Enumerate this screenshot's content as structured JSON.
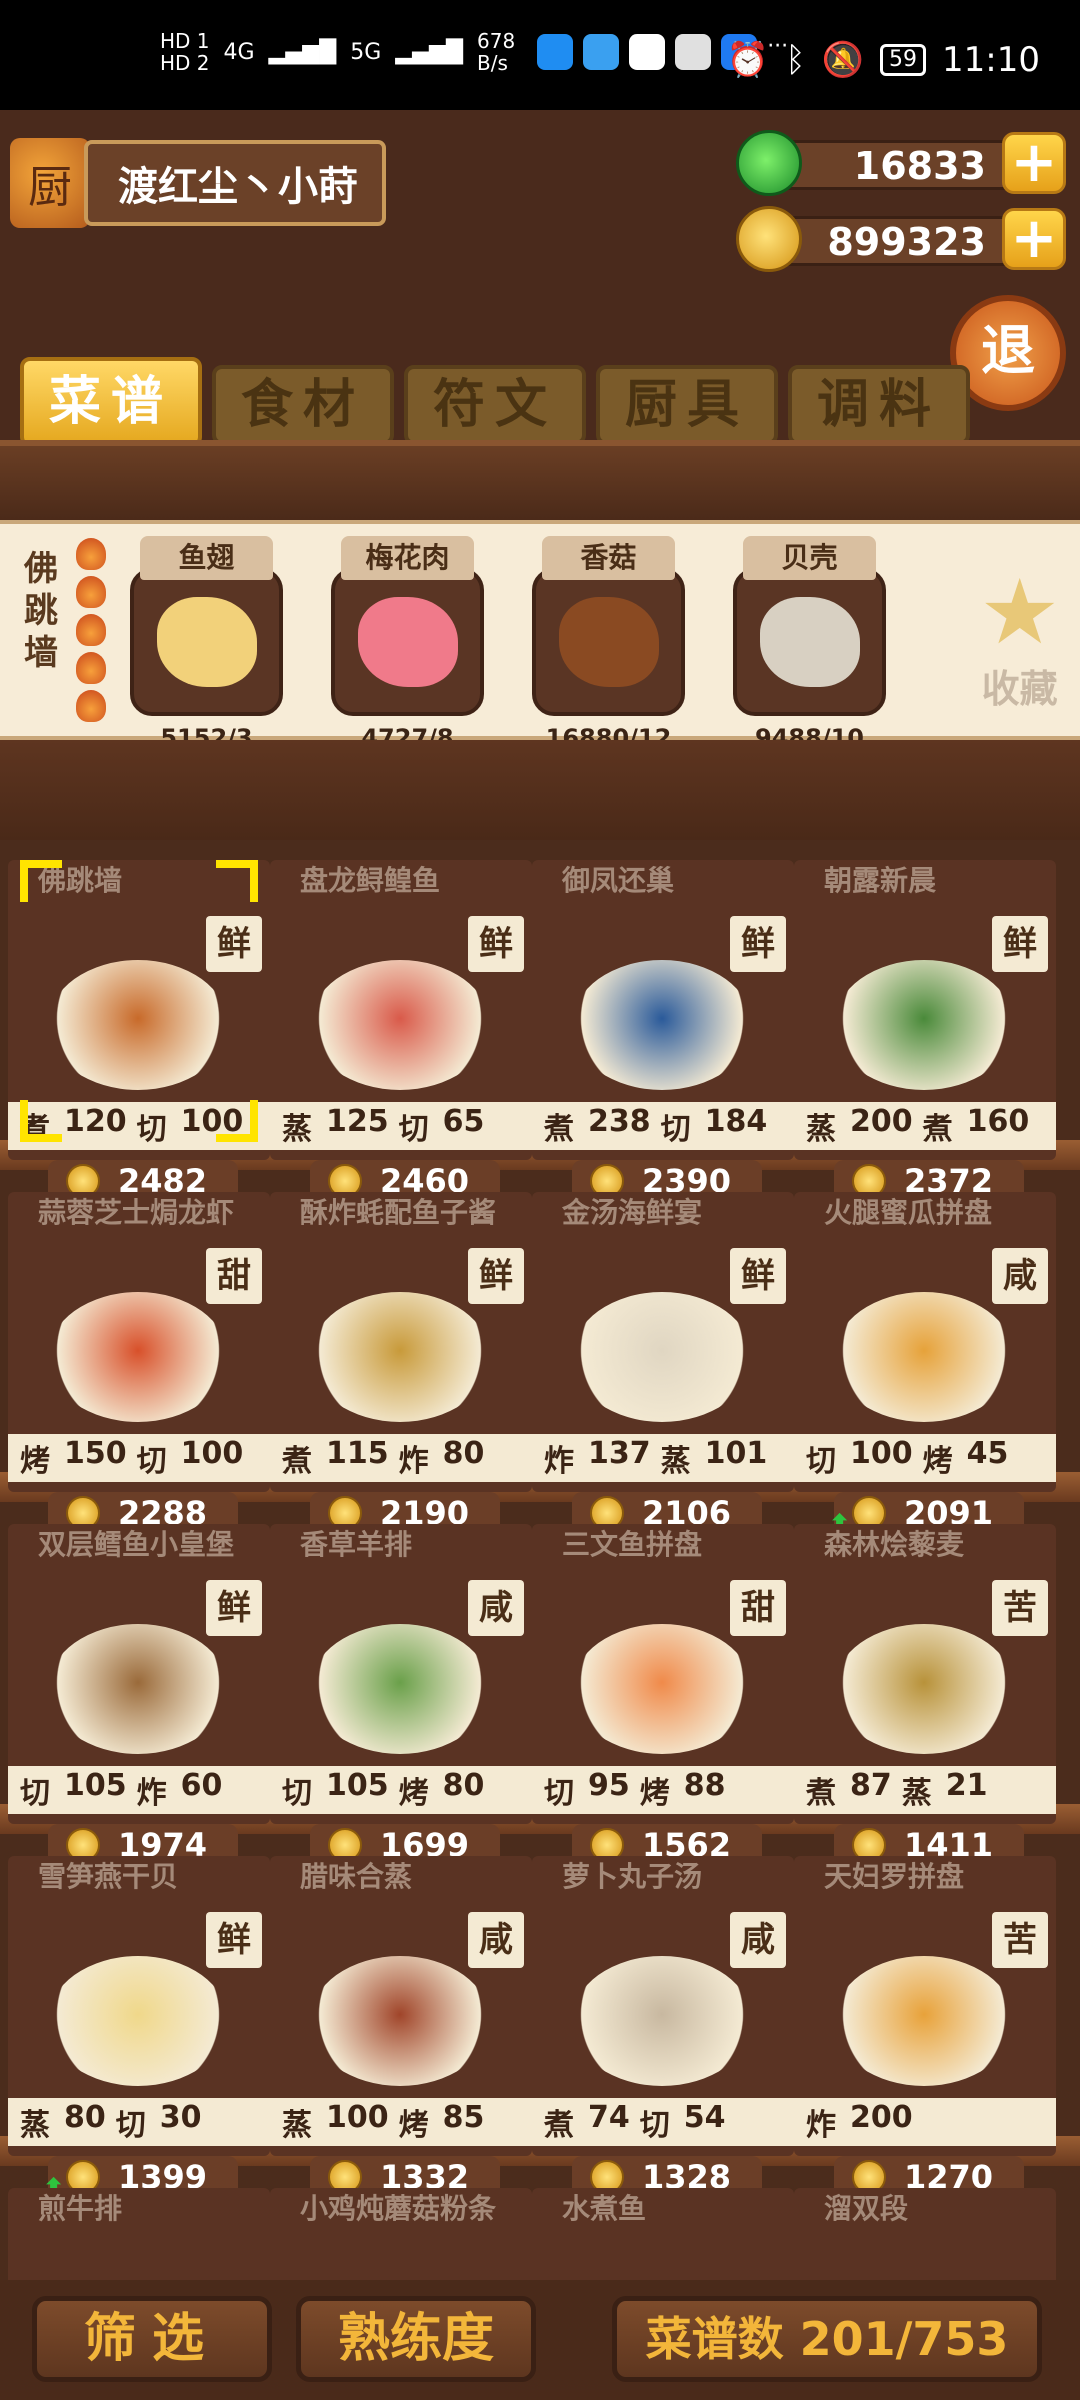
{
  "status_bar": {
    "hd1": "HD 1",
    "hd2": "HD 2",
    "net1": "4G",
    "net2": "5G",
    "speed": "678\nB/s",
    "battery": "59",
    "time": "11:10"
  },
  "player": {
    "name": "渡红尘丶小莳"
  },
  "currency": {
    "jade": "16833",
    "coins": "899323",
    "plus_label": "+"
  },
  "exit_label": "退",
  "tabs": [
    {
      "label": "菜谱",
      "active": true
    },
    {
      "label": "食材",
      "active": false
    },
    {
      "label": "符文",
      "active": false
    },
    {
      "label": "厨具",
      "active": false
    },
    {
      "label": "调料",
      "active": false
    }
  ],
  "featured": {
    "title": "佛跳墙",
    "ingredients": [
      {
        "name": "鱼翅",
        "stat": "5152/3",
        "color": "#f2d17a"
      },
      {
        "name": "梅花肉",
        "stat": "4727/8",
        "color": "#f07a8a"
      },
      {
        "name": "香菇",
        "stat": "16880/12",
        "color": "#8a4a22"
      },
      {
        "name": "贝壳",
        "stat": "9488/10",
        "color": "#d8d0c2"
      }
    ],
    "favorite_label": "收藏"
  },
  "recipes": [
    {
      "name": "佛跳墙",
      "taste": "鲜",
      "skills": [
        [
          "煮",
          "120"
        ],
        [
          "切",
          "100"
        ]
      ],
      "price": "2482",
      "selected": true,
      "dish_color": "#c86a2a"
    },
    {
      "name": "盘龙鲟鳇鱼",
      "taste": "鲜",
      "skills": [
        [
          "蒸",
          "125"
        ],
        [
          "切",
          "65"
        ]
      ],
      "price": "2460",
      "dish_color": "#d95a4a"
    },
    {
      "name": "御凤还巢",
      "taste": "鲜",
      "skills": [
        [
          "煮",
          "238"
        ],
        [
          "切",
          "184"
        ]
      ],
      "price": "2390",
      "dish_color": "#2a5a9a"
    },
    {
      "name": "朝露新晨",
      "taste": "鲜",
      "skills": [
        [
          "蒸",
          "200"
        ],
        [
          "煮",
          "160"
        ]
      ],
      "price": "2372",
      "dish_color": "#4a8a3a"
    },
    {
      "name": "蒜蓉芝士焗龙虾",
      "taste": "甜",
      "skills": [
        [
          "烤",
          "150"
        ],
        [
          "切",
          "100"
        ]
      ],
      "price": "2288",
      "dish_color": "#d8502a"
    },
    {
      "name": "酥炸蚝配鱼子酱",
      "taste": "鲜",
      "skills": [
        [
          "煮",
          "115"
        ],
        [
          "炸",
          "80"
        ]
      ],
      "price": "2190",
      "dish_color": "#c89a3a"
    },
    {
      "name": "金汤海鲜宴",
      "taste": "鲜",
      "skills": [
        [
          "炸",
          "137"
        ],
        [
          "蒸",
          "101"
        ]
      ],
      "price": "2106",
      "dish_color": "#e0d6c2"
    },
    {
      "name": "火腿蜜瓜拼盘",
      "taste": "咸",
      "skills": [
        [
          "切",
          "100"
        ],
        [
          "烤",
          "45"
        ]
      ],
      "price": "2091",
      "up": true,
      "dish_color": "#e6a23a"
    },
    {
      "name": "双层鳕鱼小皇堡",
      "taste": "鲜",
      "skills": [
        [
          "切",
          "105"
        ],
        [
          "炸",
          "60"
        ]
      ],
      "price": "1974",
      "dish_color": "#9a6a3a"
    },
    {
      "name": "香草羊排",
      "taste": "咸",
      "skills": [
        [
          "切",
          "105"
        ],
        [
          "烤",
          "80"
        ]
      ],
      "price": "1699",
      "dish_color": "#6aa04a"
    },
    {
      "name": "三文鱼拼盘",
      "taste": "甜",
      "skills": [
        [
          "切",
          "95"
        ],
        [
          "烤",
          "88"
        ]
      ],
      "price": "1562",
      "dish_color": "#f08a4a"
    },
    {
      "name": "森林烩藜麦",
      "taste": "苦",
      "skills": [
        [
          "煮",
          "87"
        ],
        [
          "蒸",
          "21"
        ]
      ],
      "price": "1411",
      "dish_color": "#b8923a"
    },
    {
      "name": "雪笋燕干贝",
      "taste": "鲜",
      "skills": [
        [
          "蒸",
          "80"
        ],
        [
          "切",
          "30"
        ]
      ],
      "price": "1399",
      "up": true,
      "dish_color": "#f0d88a"
    },
    {
      "name": "腊味合蒸",
      "taste": "咸",
      "skills": [
        [
          "蒸",
          "100"
        ],
        [
          "烤",
          "85"
        ]
      ],
      "price": "1332",
      "dish_color": "#a0452a"
    },
    {
      "name": "萝卜丸子汤",
      "taste": "咸",
      "skills": [
        [
          "煮",
          "74"
        ],
        [
          "切",
          "54"
        ]
      ],
      "price": "1328",
      "dish_color": "#c8b8a0"
    },
    {
      "name": "天妇罗拼盘",
      "taste": "苦",
      "skills": [
        [
          "炸",
          "200"
        ]
      ],
      "price": "1270",
      "dish_color": "#e8a23a"
    }
  ],
  "partial_recipes": [
    {
      "name": "煎牛排"
    },
    {
      "name": "小鸡炖蘑菇粉条"
    },
    {
      "name": "水煮鱼"
    },
    {
      "name": "溜双段"
    }
  ],
  "bottom": {
    "filter": "筛选",
    "proficiency": "熟练度",
    "recipe_count": "菜谱数 201/753"
  }
}
